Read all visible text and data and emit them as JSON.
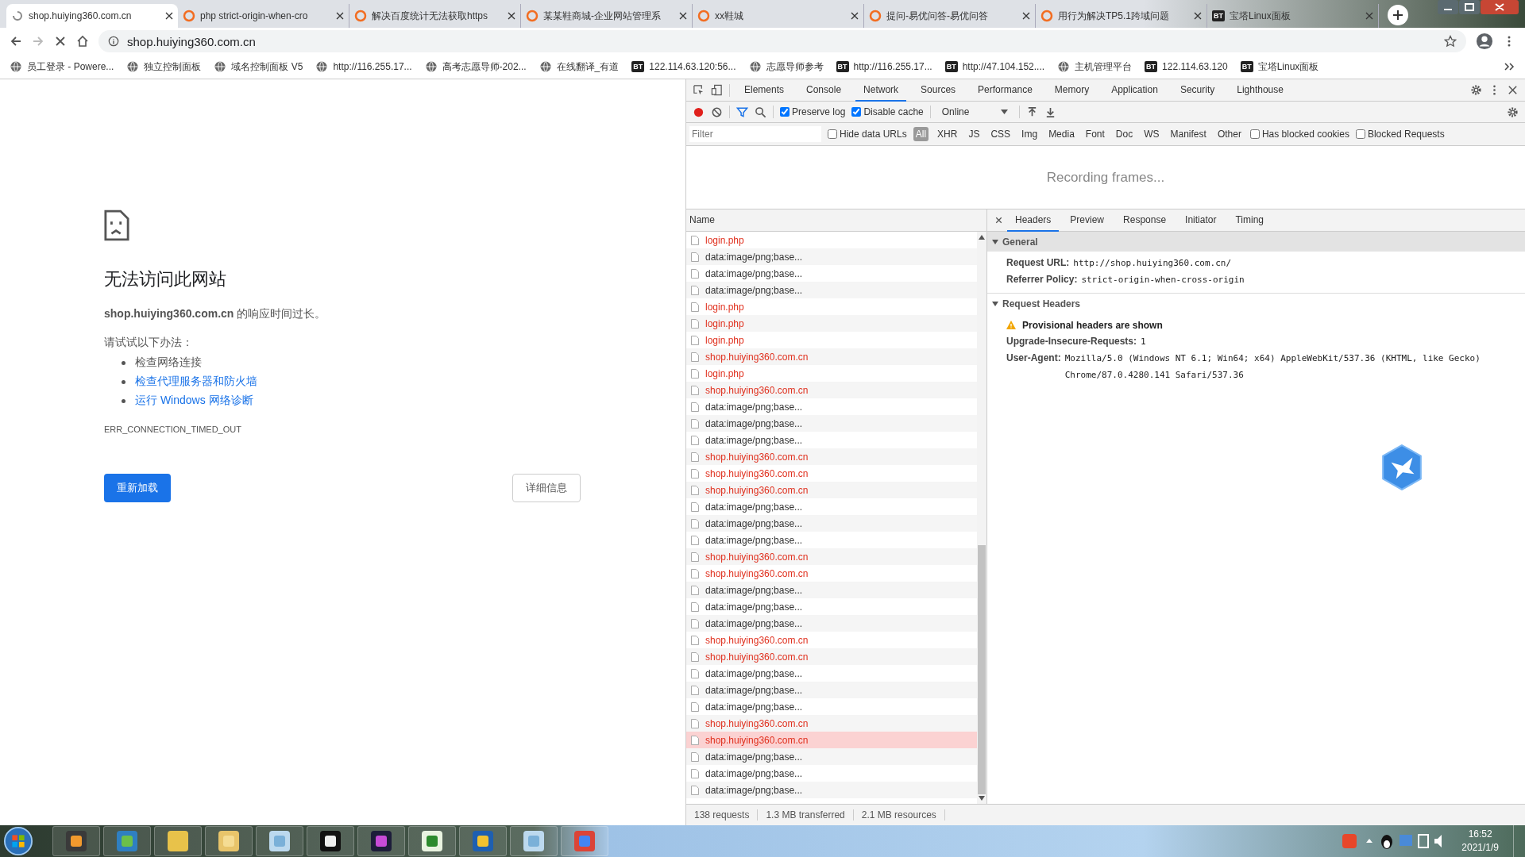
{
  "tabs": [
    {
      "title": "shop.huiying360.com.cn",
      "selected": true,
      "loading": true
    },
    {
      "title": "php strict-origin-when-cro",
      "selected": false,
      "loading": false
    },
    {
      "title": "解决百度统计无法获取https",
      "selected": false,
      "loading": false
    },
    {
      "title": "某某鞋商城-企业网站管理系",
      "selected": false,
      "loading": false
    },
    {
      "title": "xx鞋城",
      "selected": false,
      "loading": false
    },
    {
      "title": "提问-易优问答-易优问答",
      "selected": false,
      "loading": false
    },
    {
      "title": "用行为解决TP5.1跨域问题",
      "selected": false,
      "loading": false
    },
    {
      "title": "宝塔Linux面板",
      "selected": false,
      "loading": false,
      "badge": "BT"
    }
  ],
  "address_bar": {
    "url": "shop.huiying360.com.cn"
  },
  "bookmarks": [
    {
      "label": "员工登录 - Powere..."
    },
    {
      "label": "独立控制面板"
    },
    {
      "label": "域名控制面板 V5"
    },
    {
      "label": "http://116.255.17..."
    },
    {
      "label": "高考志愿导师-202..."
    },
    {
      "label": "在线翻译_有道"
    },
    {
      "label": "122.114.63.120:56...",
      "badge": "BT"
    },
    {
      "label": "志愿导师参考"
    },
    {
      "label": "http://116.255.17...",
      "badge": "BT"
    },
    {
      "label": "http://47.104.152....",
      "badge": "BT"
    },
    {
      "label": "主机管理平台"
    },
    {
      "label": "122.114.63.120",
      "badge": "BT"
    },
    {
      "label": "宝塔Linux面板",
      "badge": "BT"
    }
  ],
  "error_page": {
    "title": "无法访问此网站",
    "message": "**shop.huiying360.com.cn** 的响应时间过长。",
    "suggestions_intro": "请试试以下办法：",
    "suggestions": [
      {
        "text": "检查网络连接",
        "link": false
      },
      {
        "text": "检查代理服务器和防火墙",
        "link": true
      },
      {
        "text": "运行 Windows 网络诊断",
        "link": true
      }
    ],
    "error_code": "ERR_CONNECTION_TIMED_OUT",
    "reload_button": "重新加载",
    "details_button": "详细信息"
  },
  "devtools": {
    "tabs": [
      {
        "label": "Elements",
        "selected": false
      },
      {
        "label": "Console",
        "selected": false
      },
      {
        "label": "Network",
        "selected": true
      },
      {
        "label": "Sources",
        "selected": false
      },
      {
        "label": "Performance",
        "selected": false
      },
      {
        "label": "Memory",
        "selected": false
      },
      {
        "label": "Application",
        "selected": false
      },
      {
        "label": "Security",
        "selected": false
      },
      {
        "label": "Lighthouse",
        "selected": false
      }
    ],
    "preserve_log": {
      "label": "Preserve log",
      "checked": true
    },
    "disable_cache": {
      "label": "Disable cache",
      "checked": true
    },
    "throttling": "Online",
    "filter": {
      "placeholder": "Filter",
      "hide_data_urls": {
        "label": "Hide data URLs",
        "checked": false
      },
      "types": [
        {
          "label": "All",
          "selected": true
        },
        {
          "label": "XHR",
          "selected": false
        },
        {
          "label": "JS",
          "selected": false
        },
        {
          "label": "CSS",
          "selected": false
        },
        {
          "label": "Img",
          "selected": false
        },
        {
          "label": "Media",
          "selected": false
        },
        {
          "label": "Font",
          "selected": false
        },
        {
          "label": "Doc",
          "selected": false
        },
        {
          "label": "WS",
          "selected": false
        },
        {
          "label": "Manifest",
          "selected": false
        },
        {
          "label": "Other",
          "selected": false
        }
      ],
      "has_blocked_cookies": {
        "label": "Has blocked cookies",
        "checked": false
      },
      "blocked_requests": {
        "label": "Blocked Requests",
        "checked": false
      }
    },
    "recording_message": "Recording frames...",
    "requests": {
      "column": "Name",
      "rows": [
        {
          "name": "login.php",
          "failed": true,
          "selected": false
        },
        {
          "name": "data:image/png;base...",
          "failed": false,
          "selected": false
        },
        {
          "name": "data:image/png;base...",
          "failed": false,
          "selected": false
        },
        {
          "name": "data:image/png;base...",
          "failed": false,
          "selected": false
        },
        {
          "name": "login.php",
          "failed": true,
          "selected": false
        },
        {
          "name": "login.php",
          "failed": true,
          "selected": false
        },
        {
          "name": "login.php",
          "failed": true,
          "selected": false
        },
        {
          "name": "shop.huiying360.com.cn",
          "failed": true,
          "selected": false
        },
        {
          "name": "login.php",
          "failed": true,
          "selected": false
        },
        {
          "name": "shop.huiying360.com.cn",
          "failed": true,
          "selected": false
        },
        {
          "name": "data:image/png;base...",
          "failed": false,
          "selected": false
        },
        {
          "name": "data:image/png;base...",
          "failed": false,
          "selected": false
        },
        {
          "name": "data:image/png;base...",
          "failed": false,
          "selected": false
        },
        {
          "name": "shop.huiying360.com.cn",
          "failed": true,
          "selected": false
        },
        {
          "name": "shop.huiying360.com.cn",
          "failed": true,
          "selected": false
        },
        {
          "name": "shop.huiying360.com.cn",
          "failed": true,
          "selected": false
        },
        {
          "name": "data:image/png;base...",
          "failed": false,
          "selected": false
        },
        {
          "name": "data:image/png;base...",
          "failed": false,
          "selected": false
        },
        {
          "name": "data:image/png;base...",
          "failed": false,
          "selected": false
        },
        {
          "name": "shop.huiying360.com.cn",
          "failed": true,
          "selected": false
        },
        {
          "name": "shop.huiying360.com.cn",
          "failed": true,
          "selected": false
        },
        {
          "name": "data:image/png;base...",
          "failed": false,
          "selected": false
        },
        {
          "name": "data:image/png;base...",
          "failed": false,
          "selected": false
        },
        {
          "name": "data:image/png;base...",
          "failed": false,
          "selected": false
        },
        {
          "name": "shop.huiying360.com.cn",
          "failed": true,
          "selected": false
        },
        {
          "name": "shop.huiying360.com.cn",
          "failed": true,
          "selected": false
        },
        {
          "name": "data:image/png;base...",
          "failed": false,
          "selected": false
        },
        {
          "name": "data:image/png;base...",
          "failed": false,
          "selected": false
        },
        {
          "name": "data:image/png;base...",
          "failed": false,
          "selected": false
        },
        {
          "name": "shop.huiying360.com.cn",
          "failed": true,
          "selected": false
        },
        {
          "name": "shop.huiying360.com.cn",
          "failed": true,
          "selected": true
        },
        {
          "name": "data:image/png;base...",
          "failed": false,
          "selected": false
        },
        {
          "name": "data:image/png;base...",
          "failed": false,
          "selected": false
        },
        {
          "name": "data:image/png;base...",
          "failed": false,
          "selected": false
        }
      ]
    },
    "detail_tabs": [
      {
        "label": "Headers",
        "selected": true
      },
      {
        "label": "Preview",
        "selected": false
      },
      {
        "label": "Response",
        "selected": false
      },
      {
        "label": "Initiator",
        "selected": false
      },
      {
        "label": "Timing",
        "selected": false
      }
    ],
    "sections": [
      {
        "title": "General",
        "expanded": true,
        "fields": [
          {
            "name": "Request URL:",
            "value": "http://shop.huiying360.com.cn/"
          },
          {
            "name": "Referrer Policy:",
            "value": "strict-origin-when-cross-origin"
          }
        ]
      },
      {
        "title": "Request Headers",
        "expanded": true,
        "warning": "Provisional headers are shown",
        "fields": [
          {
            "name": "Upgrade-Insecure-Requests:",
            "value": "1"
          },
          {
            "name": "User-Agent:",
            "value": "Mozilla/5.0 (Windows NT 6.1; Win64; x64) AppleWebKit/537.36 (KHTML, like Gecko) Chrome/87.0.4280.141 Safari/537.36"
          }
        ]
      }
    ],
    "status_bar": [
      "138 requests",
      "1.3 MB transferred",
      "2.1 MB resources"
    ]
  },
  "taskbar": {
    "time": "16:52",
    "date": "2021/1/9"
  }
}
